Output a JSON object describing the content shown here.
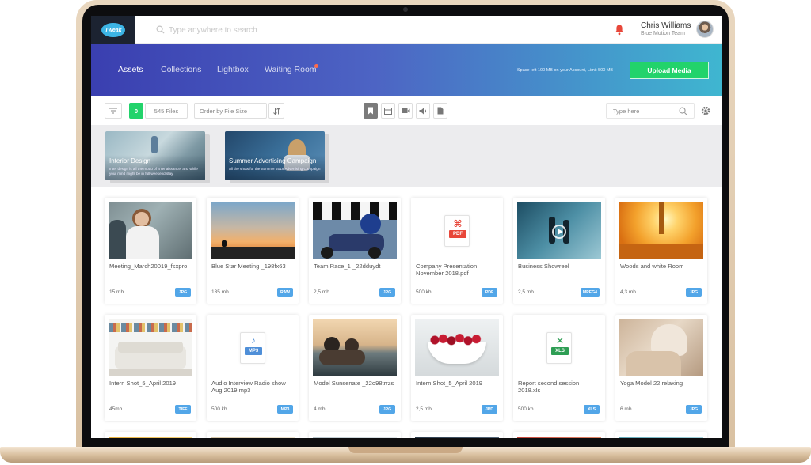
{
  "topbar": {
    "logo_text": "Tweak",
    "search_placeholder": "Type anywhere to search",
    "user_name": "Chris Williams",
    "user_team": "Blue Motion Team"
  },
  "hero": {
    "tabs": [
      {
        "label": "Assets",
        "active": true
      },
      {
        "label": "Collections",
        "active": false
      },
      {
        "label": "Lightbox",
        "active": false
      },
      {
        "label": "Waiting Room",
        "active": false
      }
    ],
    "space_text": "Space left 100 MB on your Account, Limit 500 MB",
    "upload_label": "Upload Media"
  },
  "toolbar": {
    "count": "0",
    "files_label": "545 Files",
    "order_label": "Order by File Size",
    "search_placeholder": "Type here"
  },
  "collections": [
    {
      "title": "Interior Design",
      "desc": "Inter design is all the motto of a renaissance, and while your mind might be in full weekend stay."
    },
    {
      "title": "Summer Advertising Campaign",
      "desc": "All the shots for the Summer 2019 Advertising Campaign"
    }
  ],
  "assets": [
    {
      "name": "Meeting_March20019_fsxpro",
      "size": "15 mb",
      "type": "JPG"
    },
    {
      "name": "Blue Star Meeting _198fx63",
      "size": "135 mb",
      "type": "RAW"
    },
    {
      "name": "Team Race_1 _22dduydt",
      "size": "2,5 mb",
      "type": "JPG"
    },
    {
      "name": "Company Presentation November 2018.pdf",
      "size": "500 kb",
      "type": "PDF"
    },
    {
      "name": "Business Showreel",
      "size": "2,5 mb",
      "type": "MPEG4"
    },
    {
      "name": "Woods and white Room",
      "size": "4,3 mb",
      "type": "JPG"
    },
    {
      "name": "Intern Shot_5_April 2019",
      "size": "45mb",
      "type": "TIFF"
    },
    {
      "name": "Audio Interview Radio show Aug 2019.mp3",
      "size": "500 kb",
      "type": "MP3"
    },
    {
      "name": "Model Sunsenate _22o98trrzs",
      "size": "4 mb",
      "type": "JPG"
    },
    {
      "name": "Intern Shot_5_April 2019",
      "size": "2,5 mb",
      "type": "JPD"
    },
    {
      "name": "Report second session 2018.xls",
      "size": "500 kb",
      "type": "XLS"
    },
    {
      "name": "Yoga Model 22 relaxing",
      "size": "6 mb",
      "type": "JPG"
    }
  ],
  "file_icons": {
    "pdf": {
      "tag": "PDF",
      "color": "#e8473a"
    },
    "mp3": {
      "tag": "MP3",
      "color": "#4f8fd8"
    },
    "xls": {
      "tag": "XLS",
      "color": "#2e9e54"
    }
  }
}
